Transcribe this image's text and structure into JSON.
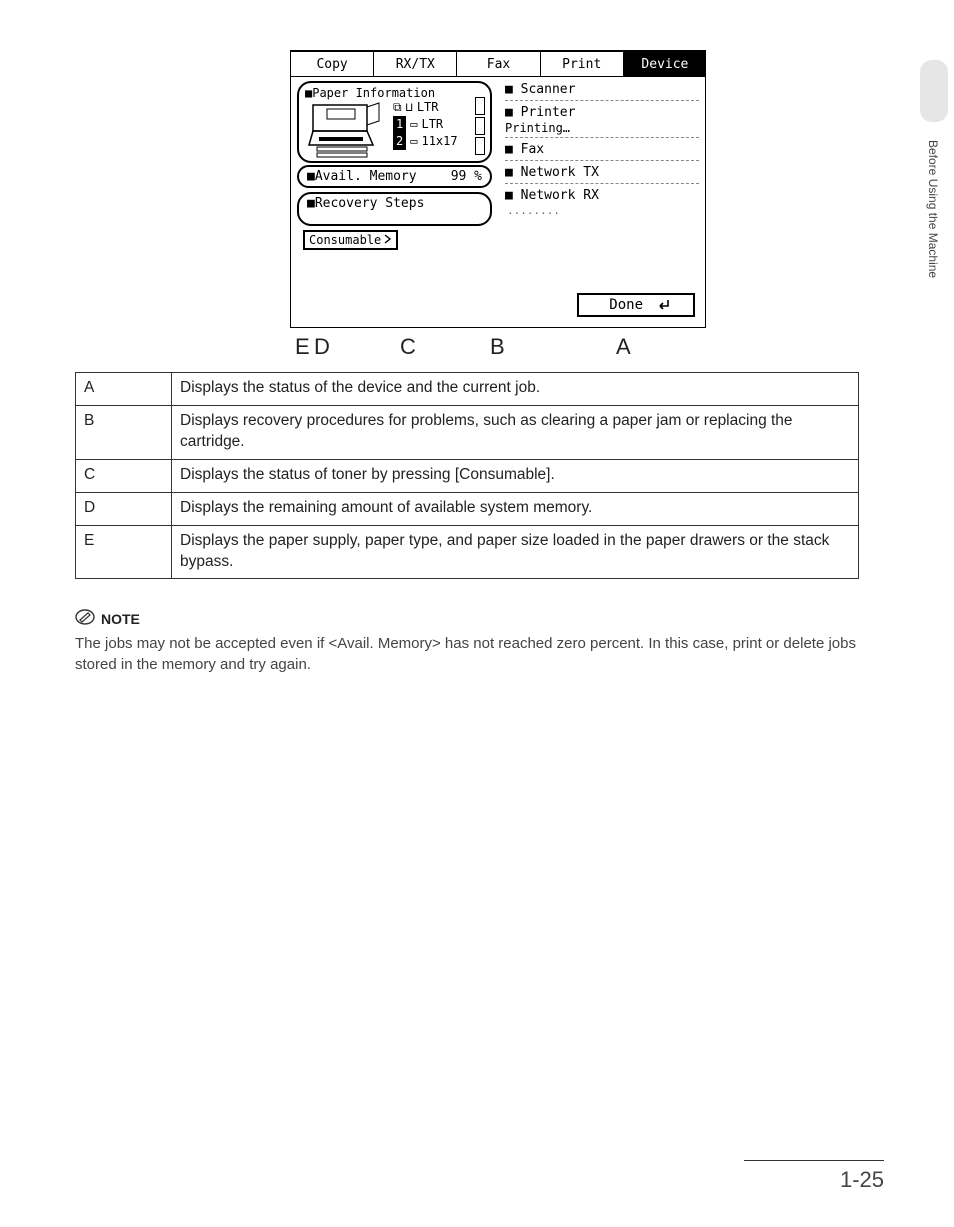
{
  "side_tab": {
    "label": "Before Using the Machine"
  },
  "screen": {
    "tabs": {
      "copy": "Copy",
      "rxtx": "RX/TX",
      "fax": "Fax",
      "print": "Print",
      "device": "Device"
    },
    "paper_info": {
      "title": "■Paper Information",
      "line1_icon": "⧉",
      "line1_orient": "⊔",
      "line1_size": "LTR",
      "line2_icon": "1",
      "line2_orient": "▭",
      "line2_size": "LTR",
      "line3_icon": "2",
      "line3_orient": "▭",
      "line3_size": "11x17"
    },
    "avail": {
      "label": "■Avail. Memory",
      "value": "99 %"
    },
    "recovery": {
      "label": "■Recovery Steps"
    },
    "consumable": {
      "label": "Consumable"
    },
    "status": {
      "scanner": "■ Scanner",
      "printer": "■ Printer",
      "printer_sub": "Printing…",
      "fax": "■ Fax",
      "ntx": "■ Network TX",
      "nrx": "■ Network RX"
    },
    "done": "Done"
  },
  "callouts": {
    "E": "E",
    "D": "D",
    "C": "C",
    "B": "B",
    "A": "A"
  },
  "table": {
    "A": {
      "key": "A",
      "text": "Displays the status of the device and the current job."
    },
    "B": {
      "key": "B",
      "text": "Displays recovery procedures for problems, such as clearing a paper jam or replacing the cartridge."
    },
    "C": {
      "key": "C",
      "text": "Displays the status of toner by pressing [Consumable]."
    },
    "D": {
      "key": "D",
      "text": "Displays the remaining amount of available system memory."
    },
    "E": {
      "key": "E",
      "text": "Displays the paper supply, paper type, and paper size loaded in the paper drawers or the stack bypass."
    }
  },
  "note": {
    "label": "NOTE",
    "text": "The jobs may not be accepted even if <Avail. Memory> has not reached zero percent. In this case, print or delete jobs stored in the memory and try again."
  },
  "footer": {
    "page": "1-25"
  }
}
